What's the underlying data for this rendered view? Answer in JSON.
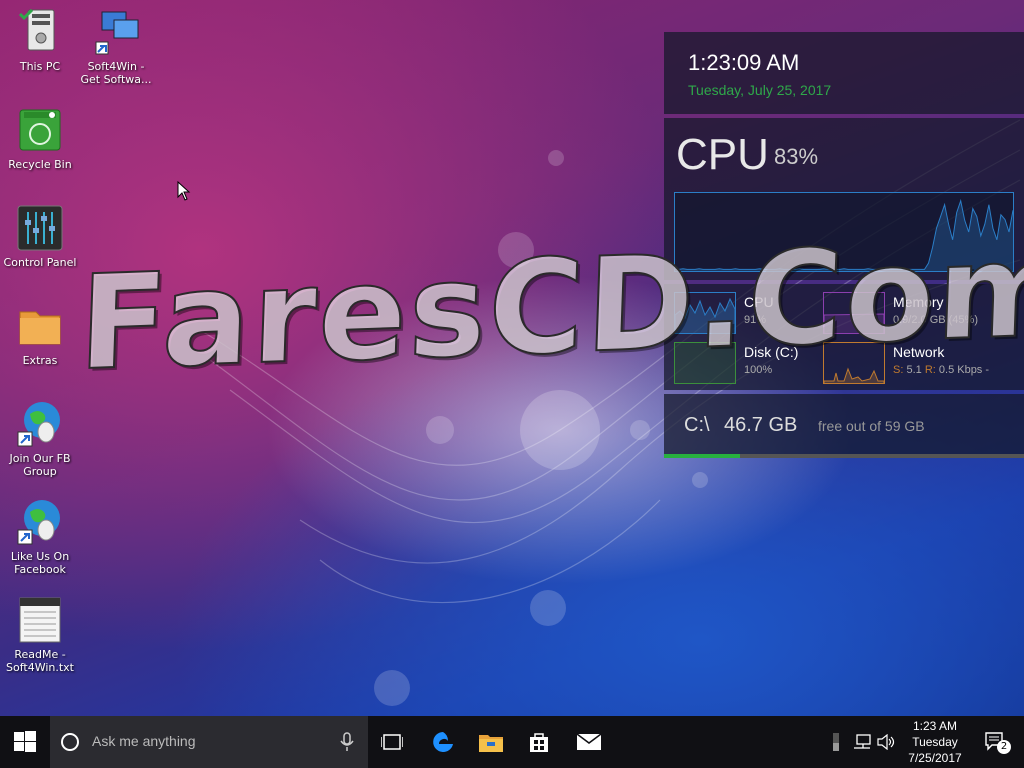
{
  "desktop": {
    "icons": [
      {
        "label_line1": "This PC",
        "label_line2": "",
        "icon": "computer-icon"
      },
      {
        "label_line1": "Soft4Win -",
        "label_line2": "Get Softwa...",
        "icon": "network-computers-icon"
      },
      {
        "label_line1": "Recycle Bin",
        "label_line2": "",
        "icon": "recycle-bin-icon"
      },
      {
        "label_line1": "Control Panel",
        "label_line2": "",
        "icon": "control-panel-icon"
      },
      {
        "label_line1": "Extras",
        "label_line2": "",
        "icon": "folder-icon"
      },
      {
        "label_line1": "Join Our FB",
        "label_line2": "Group",
        "icon": "globe-shortcut-icon"
      },
      {
        "label_line1": "Like Us On",
        "label_line2": "Facebook",
        "icon": "globe-shortcut-icon"
      },
      {
        "label_line1": "ReadMe -",
        "label_line2": "Soft4Win.txt",
        "icon": "text-document-icon"
      }
    ],
    "watermark": "FaresCD.Com"
  },
  "gadgets": {
    "clock": {
      "time": "1:23:09 AM",
      "date": "Tuesday, July 25, 2017",
      "date_color": "#2fa84a"
    },
    "cpu": {
      "title": "CPU",
      "percent": "83%",
      "graph_color": "#2b7ec7",
      "history": [
        2,
        2,
        3,
        2,
        2,
        2,
        3,
        2,
        2,
        2,
        2,
        3,
        2,
        2,
        2,
        3,
        2,
        2,
        2,
        2,
        2,
        3,
        2,
        2,
        2,
        2,
        3,
        2,
        2,
        2,
        2,
        3,
        2,
        2,
        2,
        2,
        2,
        3,
        2,
        2,
        2,
        2,
        3,
        2,
        2,
        2,
        2,
        2,
        3,
        2,
        2,
        2,
        3,
        2,
        2,
        2,
        2,
        3,
        2,
        2,
        2,
        2,
        2,
        10,
        30,
        55,
        70,
        85,
        60,
        40,
        75,
        90,
        65,
        50,
        80,
        70,
        45,
        60,
        85,
        55,
        40,
        72,
        66,
        50,
        78
      ]
    },
    "resources": [
      {
        "name": "CPU",
        "value": "91%",
        "color": "#2b7ec7"
      },
      {
        "name": "Memory",
        "value": "0.9/2.0 GB (45%)",
        "color": "#8b3fae"
      },
      {
        "name": "Disk (C:)",
        "value": "100%",
        "color": "#3c8f3c"
      },
      {
        "name": "Network",
        "value_s_label": "S:",
        "value_s": "5.1",
        "value_r_label": "R:",
        "value_r": "0.5 Kbps -",
        "color": "#c07a2f"
      }
    ],
    "drive": {
      "path": "C:\\",
      "size": "46.7 GB",
      "free_text": "free out of 59 GB",
      "used_fraction": 0.21,
      "bar_color": "#27b03f"
    }
  },
  "taskbar": {
    "search_placeholder": "Ask me anything",
    "clock_time": "1:23 AM",
    "clock_day": "Tuesday",
    "clock_date": "7/25/2017",
    "notification_count": "2",
    "pinned": [
      "edge-icon",
      "file-explorer-icon",
      "store-icon",
      "mail-icon"
    ]
  }
}
